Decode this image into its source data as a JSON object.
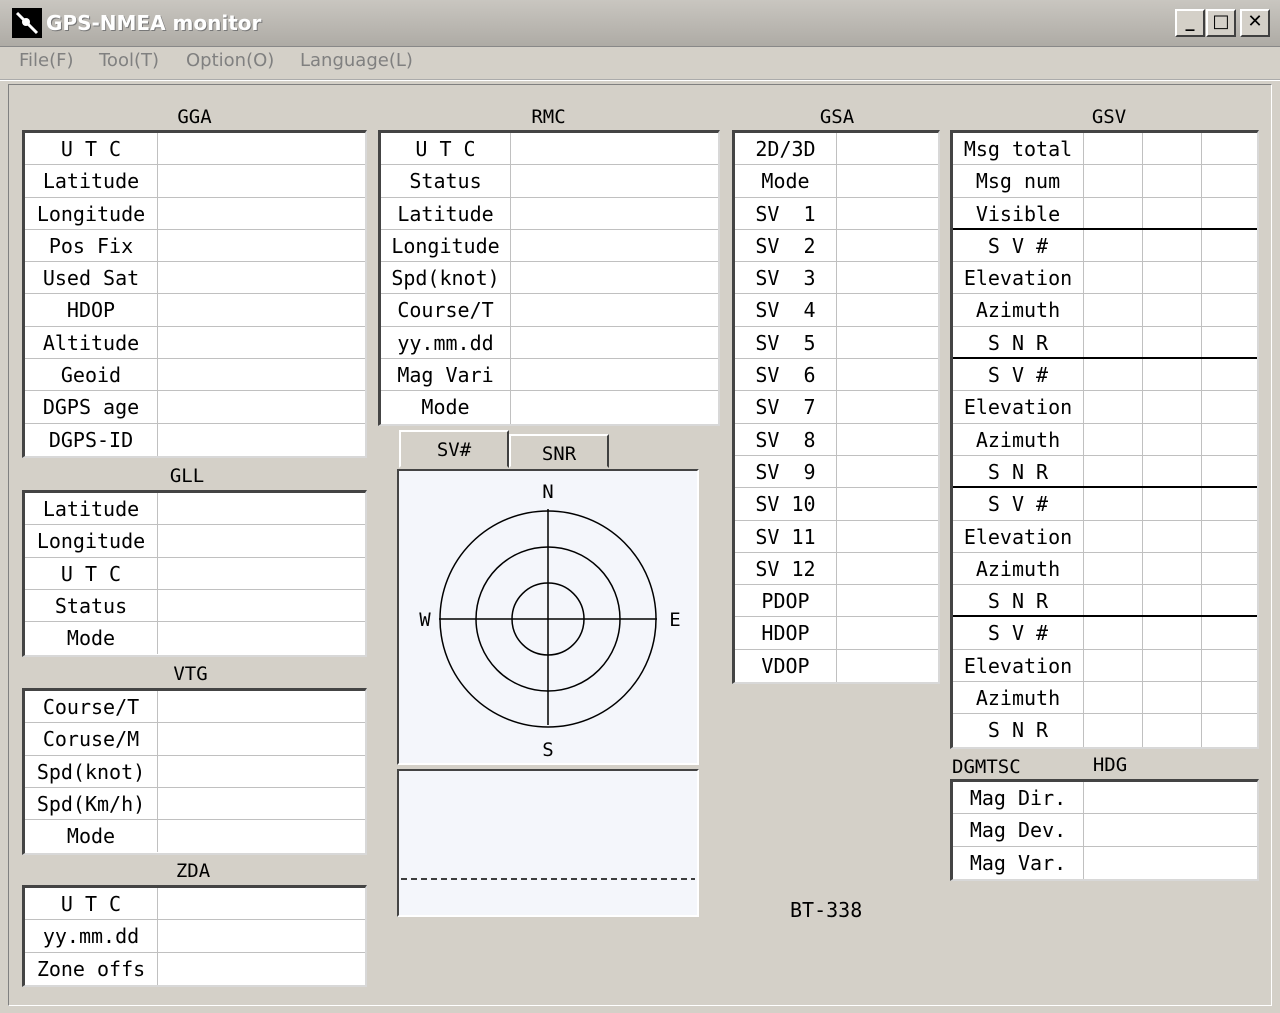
{
  "window": {
    "title": "GPS-NMEA monitor"
  },
  "menu": [
    {
      "id": "file",
      "label": "File(F)"
    },
    {
      "id": "tool",
      "label": "Tool(T)"
    },
    {
      "id": "option",
      "label": "Option(O)"
    },
    {
      "id": "language",
      "label": "Language(L)"
    }
  ],
  "gga": {
    "title": "GGA",
    "rows": [
      "U T C",
      "Latitude",
      "Longitude",
      "Pos Fix",
      "Used Sat",
      "HDOP",
      "Altitude",
      "Geoid",
      "DGPS age",
      "DGPS-ID"
    ]
  },
  "gll": {
    "title": "GLL",
    "rows": [
      "Latitude",
      "Longitude",
      "U T C",
      "Status",
      "Mode"
    ]
  },
  "vtg": {
    "title": "VTG",
    "rows": [
      "Course/T",
      "Coruse/M",
      "Spd(knot)",
      "Spd(Km/h)",
      "Mode"
    ]
  },
  "zda": {
    "title": "ZDA",
    "rows": [
      "U T C",
      "yy.mm.dd",
      "Zone offs"
    ]
  },
  "rmc": {
    "title": "RMC",
    "rows": [
      "U T C",
      "Status",
      "Latitude",
      "Longitude",
      "Spd(knot)",
      "Course/T",
      "yy.mm.dd",
      "Mag Vari",
      "Mode"
    ]
  },
  "gsa": {
    "title": "GSA",
    "rows": [
      "2D/3D",
      "Mode",
      "SV  1",
      "SV  2",
      "SV  3",
      "SV  4",
      "SV  5",
      "SV  6",
      "SV  7",
      "SV  8",
      "SV  9",
      "SV 10",
      "SV 11",
      "SV 12",
      "PDOP",
      "HDOP",
      "VDOP"
    ]
  },
  "gsv": {
    "title": "GSV",
    "rows": [
      "Msg total",
      "Msg num",
      "Visible",
      "S V #",
      "Elevation",
      "Azimuth",
      "S N R",
      "S V #",
      "Elevation",
      "Azimuth",
      "S N R",
      "S V #",
      "Elevation",
      "Azimuth",
      "S N R",
      "S V #",
      "Elevation",
      "Azimuth",
      "S N R"
    ]
  },
  "hdg": {
    "title_left": "DGMTSC",
    "title": "HDG",
    "rows": [
      "Mag Dir.",
      "Mag Dev.",
      "Mag Var."
    ]
  },
  "tabs": [
    {
      "id": "svnum",
      "label": "SV#"
    },
    {
      "id": "snr",
      "label": "SNR"
    }
  ],
  "skyplot": {
    "north": "N",
    "south": "S",
    "east": "E",
    "west": "W"
  },
  "model": "BT-338"
}
